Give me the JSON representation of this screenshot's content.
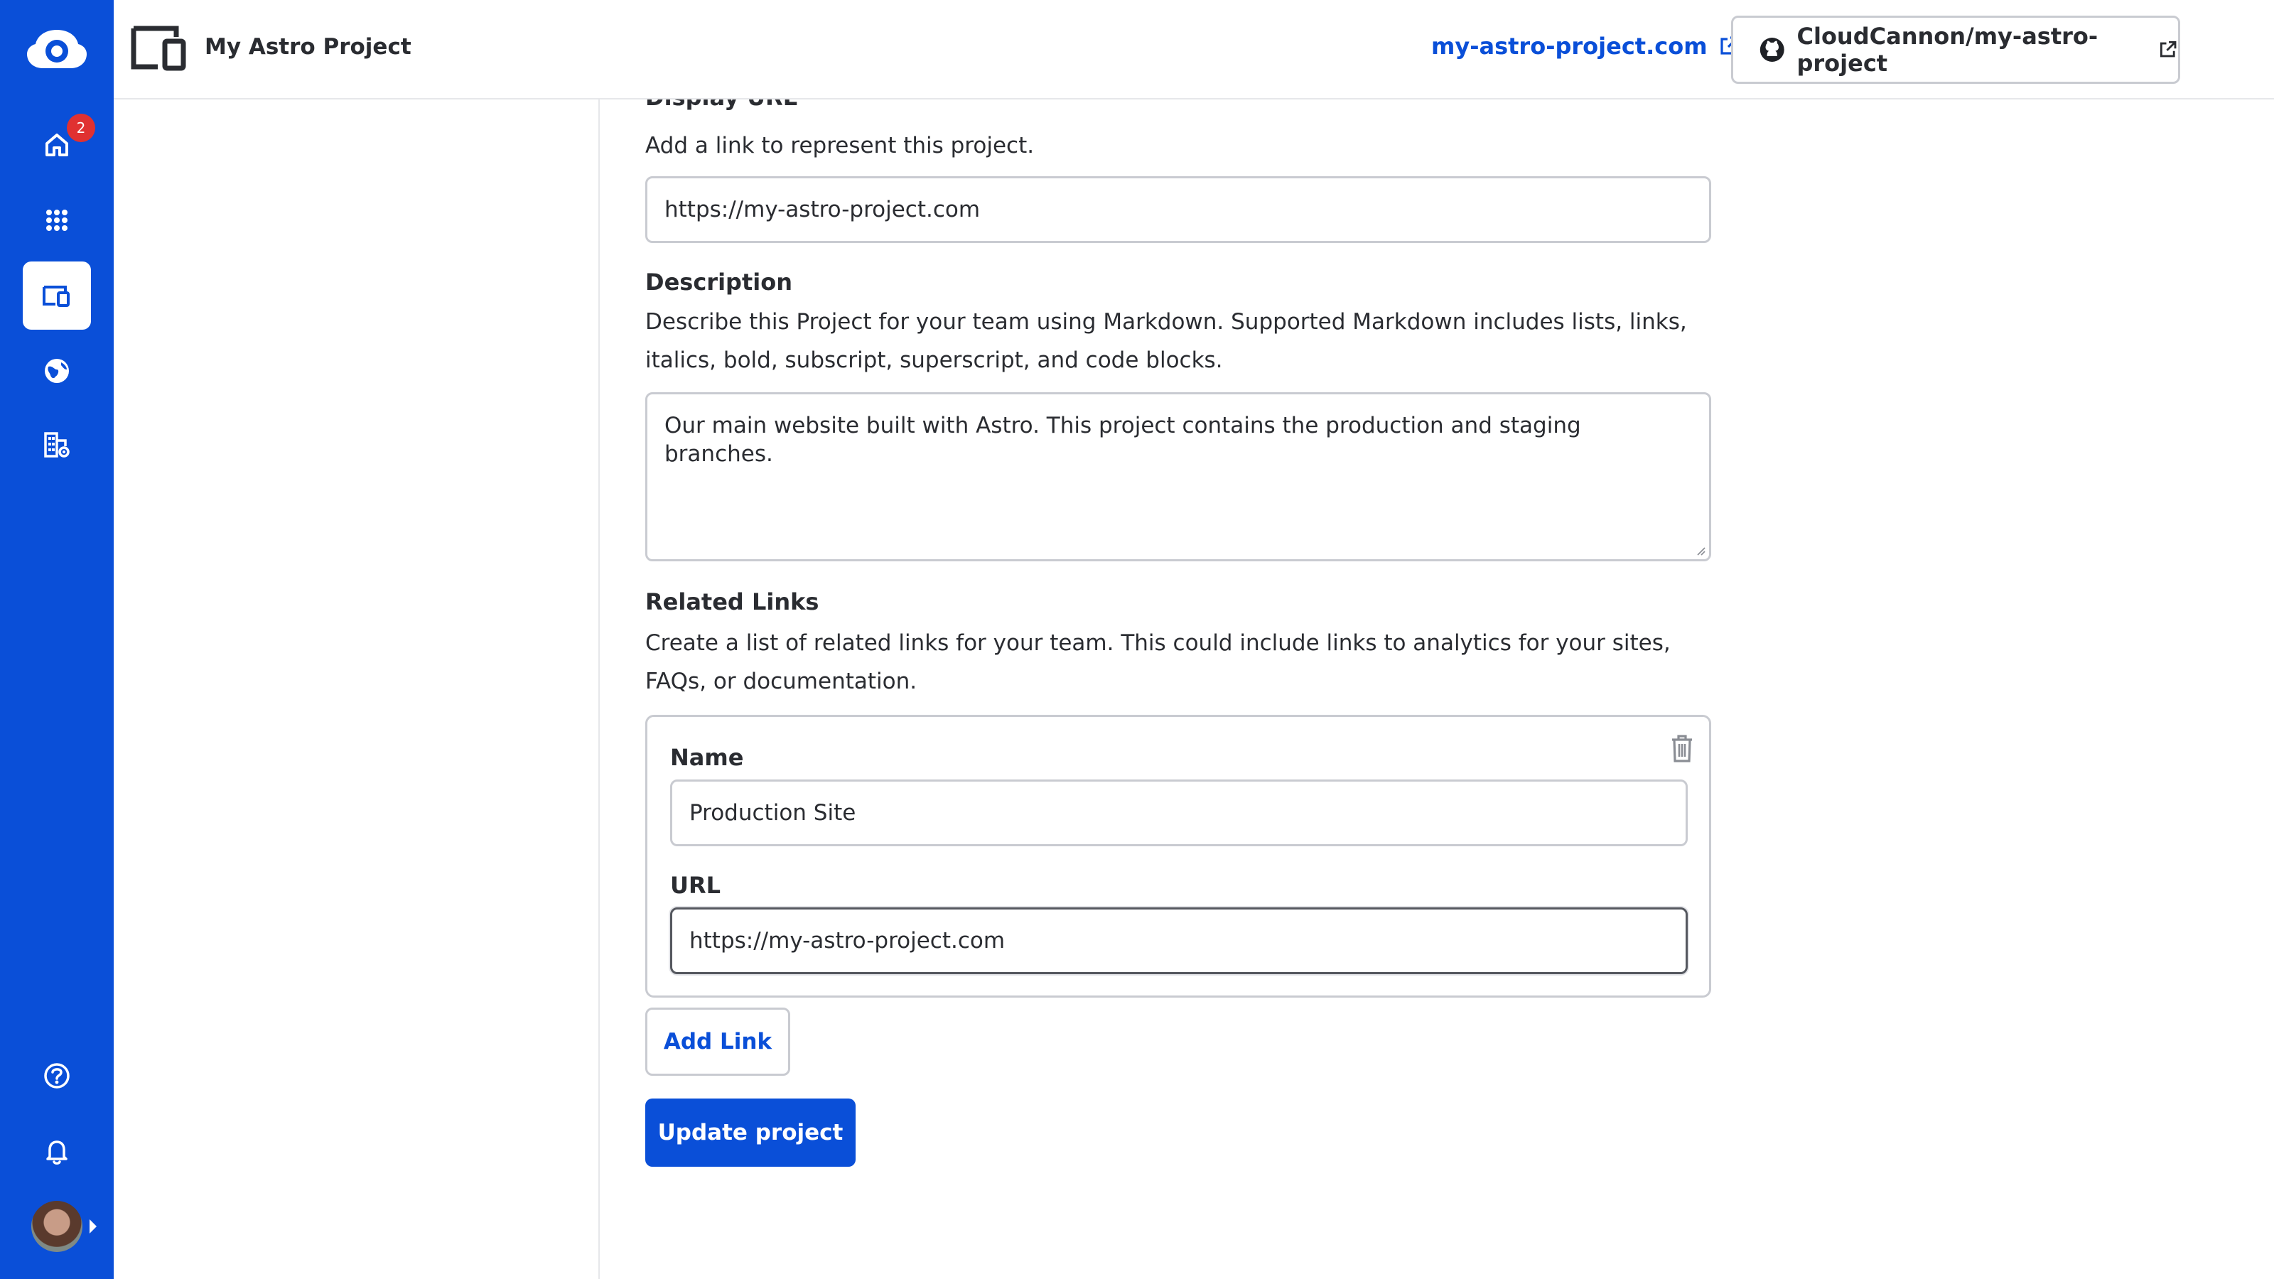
{
  "topbar": {
    "project_name": "My Astro Project",
    "site_link": "my-astro-project.com",
    "repo_label": "CloudCannon/my-astro-project",
    "icons": [
      "project-icon",
      "external-link-icon",
      "github-icon",
      "more-vertical-icon"
    ]
  },
  "rail": {
    "notification_count": "2",
    "items": [
      {
        "name": "home",
        "icon": "home-icon"
      },
      {
        "name": "apps",
        "icon": "grid-icon"
      },
      {
        "name": "projects",
        "icon": "devices-icon",
        "active": true
      },
      {
        "name": "sites",
        "icon": "globe-icon"
      },
      {
        "name": "organization",
        "icon": "org-settings-icon"
      },
      {
        "name": "help",
        "icon": "help-icon"
      },
      {
        "name": "notifications",
        "icon": "bell-icon"
      }
    ]
  },
  "form": {
    "display_url": {
      "label": "Display URL",
      "help": "Add a link to represent this project.",
      "value": "https://my-astro-project.com"
    },
    "description": {
      "label": "Description",
      "help": "Describe this Project for your team using Markdown. Supported Markdown includes lists, links, italics, bold, subscript, superscript, and code blocks.",
      "value": "Our main website built with Astro. This project contains the production and staging branches."
    },
    "related_links": {
      "label": "Related Links",
      "help": "Create a list of related links for your team. This could include links to analytics for your sites, FAQs, or documentation.",
      "items": [
        {
          "name_label": "Name",
          "name_value": "Production Site",
          "url_label": "URL",
          "url_value": "https://my-astro-project.com"
        }
      ],
      "add_label": "Add Link"
    },
    "submit_label": "Update project"
  },
  "colors": {
    "brand": "#0a4fd8",
    "badge": "#e03131",
    "border": "#c9cbd1"
  }
}
